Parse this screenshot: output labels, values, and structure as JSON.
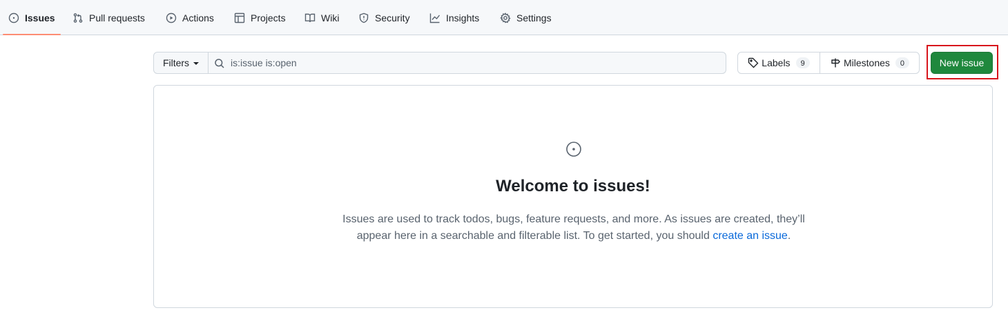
{
  "nav": {
    "tabs": [
      {
        "label": "Issues",
        "icon": "issue-opened-icon",
        "selected": true
      },
      {
        "label": "Pull requests",
        "icon": "git-pull-request-icon"
      },
      {
        "label": "Actions",
        "icon": "play-icon"
      },
      {
        "label": "Projects",
        "icon": "table-icon"
      },
      {
        "label": "Wiki",
        "icon": "book-icon"
      },
      {
        "label": "Security",
        "icon": "shield-icon"
      },
      {
        "label": "Insights",
        "icon": "graph-icon"
      },
      {
        "label": "Settings",
        "icon": "gear-icon"
      }
    ],
    "underline_color": "#fd8c73"
  },
  "subnav": {
    "filters_label": "Filters",
    "search_value": "is:issue is:open",
    "labels_label": "Labels",
    "labels_count": "9",
    "milestones_label": "Milestones",
    "milestones_count": "0",
    "new_issue_label": "New issue"
  },
  "blankslate": {
    "icon": "issue-opened-icon",
    "title": "Welcome to issues!",
    "text_line1": "Issues are used to track todos, bugs, feature requests, and more. As issues are created, they’ll",
    "text_line2": "appear here in a searchable and filterable list. To get started, you should ",
    "link_text": "create an issue",
    "text_end": "."
  },
  "colors": {
    "primary_button": "#1f883d",
    "link": "#0969da",
    "highlight": "#d8141b"
  }
}
